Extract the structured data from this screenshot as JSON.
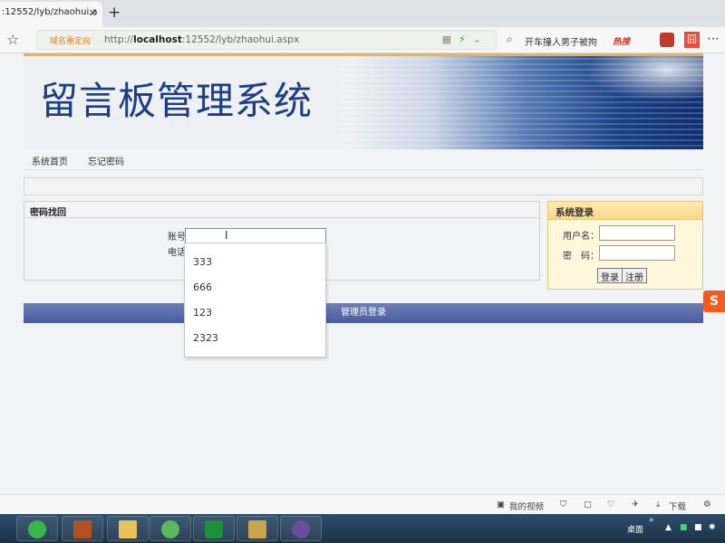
{
  "browser": {
    "tab_title": ":12552/lyb/zhaohui.a",
    "tab_close": "✕",
    "new_tab": "+",
    "redirect_badge": "域名重定向",
    "url_prefix": "http://",
    "url_host": "localhost",
    "url_rest": ":12552/lyb/zhaohui.aspx",
    "search_text": "开车撞人男子被拘",
    "hot_label": "热搜",
    "ext_label": "囧"
  },
  "page": {
    "banner_title": "留言板管理系统",
    "nav": {
      "home": "系统首页",
      "forgot": "忘记密码"
    },
    "recover": {
      "heading": "密码找回",
      "account_label": "账号",
      "phone_label": "电话",
      "suggestions": [
        "333",
        "666",
        "123",
        "2323"
      ]
    },
    "login": {
      "heading": "系统登录",
      "username_label": "用户名：",
      "password_label": "密　码：",
      "login_button": "登录",
      "register_button": "注册"
    },
    "footer_button": "管理员登录"
  },
  "statusbar": {
    "video": "我的视频",
    "download": "下载"
  },
  "taskbar": {
    "desktop": "桌面"
  },
  "colors": {
    "banner_title": "#1a3f86",
    "footer_bar": "#5468a6",
    "login_panel": "#fff7dc",
    "accent_orange": "#f0b33c"
  }
}
